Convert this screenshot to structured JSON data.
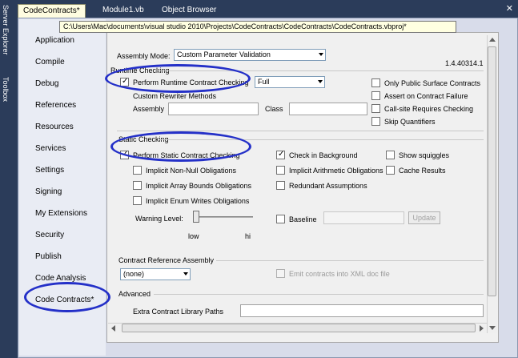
{
  "tabs": [
    {
      "label": "CodeContracts*",
      "active": true
    },
    {
      "label": "Module1.vb",
      "active": false
    },
    {
      "label": "Object Browser",
      "active": false
    }
  ],
  "side_toolbars": {
    "server_explorer": "Server Explorer",
    "toolbox": "Toolbox"
  },
  "tooltip": "C:\\Users\\Mac\\documents\\visual studio 2010\\Projects\\CodeContracts\\CodeContracts\\CodeContracts.vbproj*",
  "nav": [
    "Application",
    "Compile",
    "Debug",
    "References",
    "Resources",
    "Services",
    "Settings",
    "Signing",
    "My Extensions",
    "Security",
    "Publish",
    "Code Analysis",
    "Code Contracts*"
  ],
  "assembly_mode": {
    "label": "Assembly Mode:",
    "value": "Custom Parameter Validation"
  },
  "version": "1.4.40314.1",
  "runtime": {
    "header": "Runtime Checking",
    "perform_label": "Perform Runtime Contract Checking",
    "perform_checked": true,
    "level": "Full",
    "rewriter_header": "Custom Rewriter Methods",
    "assembly_label": "Assembly",
    "class_label": "Class",
    "options": [
      {
        "label": "Only Public Surface Contracts",
        "checked": false
      },
      {
        "label": "Assert on Contract Failure",
        "checked": false
      },
      {
        "label": "Call-site Requires Checking",
        "checked": false
      },
      {
        "label": "Skip Quantifiers",
        "checked": false
      }
    ]
  },
  "static": {
    "header": "Static Checking",
    "perform_label": "Perform Static Contract Checking",
    "perform_checked": true,
    "check_background": {
      "label": "Check in Background",
      "checked": true
    },
    "show_squiggles": {
      "label": "Show squiggles",
      "checked": false
    },
    "cache_results": {
      "label": "Cache Results",
      "checked": false
    },
    "implicit_non_null": {
      "label": "Implicit Non-Null Obligations",
      "checked": false
    },
    "implicit_arithmetic": {
      "label": "Implicit Arithmetic Obligations",
      "checked": false
    },
    "implicit_array_bounds": {
      "label": "Implicit Array Bounds Obligations",
      "checked": false
    },
    "redundant_assumptions": {
      "label": "Redundant Assumptions",
      "checked": false
    },
    "implicit_enum": {
      "label": "Implicit Enum Writes Obligations",
      "checked": false
    },
    "warning_level_label": "Warning Level:",
    "warning_level": 0,
    "low_label": "low",
    "hi_label": "hi",
    "baseline": {
      "label": "Baseline",
      "checked": false
    },
    "update_label": "Update"
  },
  "reference_assembly": {
    "header": "Contract Reference Assembly",
    "value": "(none)",
    "emit_xml_label": "Emit contracts into XML doc file"
  },
  "advanced": {
    "header": "Advanced",
    "extra_paths_label": "Extra Contract Library Paths"
  },
  "colors": {
    "highlight_ellipse": "#2430c8",
    "tab_background": "#2b3c5a",
    "tooltip_background": "#ffffe1"
  }
}
